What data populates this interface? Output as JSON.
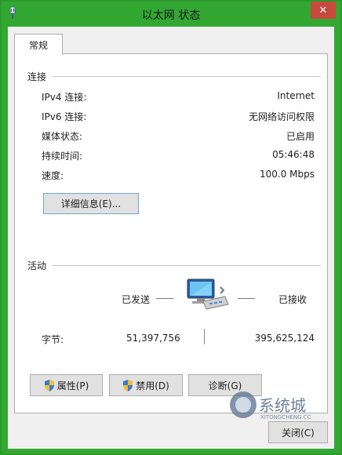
{
  "window": {
    "title": "以太网 状态",
    "close_glyph": "✕",
    "frame_color": "#32a832",
    "close_color": "#c74a3c"
  },
  "tab": {
    "label": "常规"
  },
  "connection": {
    "header": "连接",
    "rows": [
      {
        "label": "IPv4 连接:",
        "value": "Internet"
      },
      {
        "label": "IPv6 连接:",
        "value": "无网络访问权限"
      },
      {
        "label": "媒体状态:",
        "value": "已启用"
      },
      {
        "label": "持续时间:",
        "value": "05:46:48"
      },
      {
        "label": "速度:",
        "value": "100.0 Mbps"
      }
    ],
    "details_button": "详细信息(E)..."
  },
  "activity": {
    "header": "活动",
    "sent_label": "已发送",
    "received_label": "已接收",
    "bytes_label": "字节:",
    "bytes_sent": "51,397,756",
    "bytes_received": "395,625,124",
    "icon": "network-computers-icon"
  },
  "buttons": {
    "properties": "属性(P)",
    "disable": "禁用(D)",
    "diagnose": "诊断(G)",
    "close": "关闭(C)"
  },
  "watermark": {
    "text": "系统城",
    "sub": "XITONGCHENG.CC"
  }
}
